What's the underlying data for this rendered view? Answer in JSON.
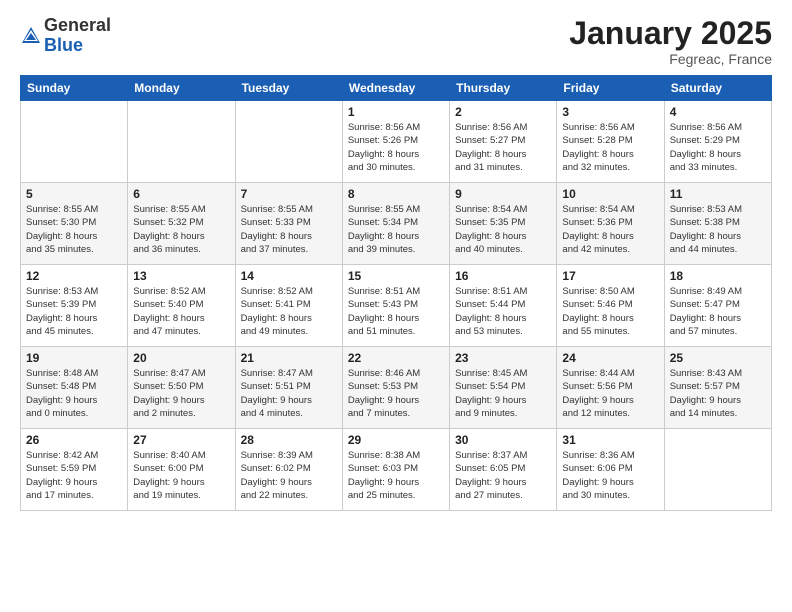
{
  "header": {
    "logo_line1": "General",
    "logo_line2": "Blue",
    "month": "January 2025",
    "location": "Fegreac, France"
  },
  "weekdays": [
    "Sunday",
    "Monday",
    "Tuesday",
    "Wednesday",
    "Thursday",
    "Friday",
    "Saturday"
  ],
  "weeks": [
    [
      {
        "day": "",
        "info": ""
      },
      {
        "day": "",
        "info": ""
      },
      {
        "day": "",
        "info": ""
      },
      {
        "day": "1",
        "info": "Sunrise: 8:56 AM\nSunset: 5:26 PM\nDaylight: 8 hours\nand 30 minutes."
      },
      {
        "day": "2",
        "info": "Sunrise: 8:56 AM\nSunset: 5:27 PM\nDaylight: 8 hours\nand 31 minutes."
      },
      {
        "day": "3",
        "info": "Sunrise: 8:56 AM\nSunset: 5:28 PM\nDaylight: 8 hours\nand 32 minutes."
      },
      {
        "day": "4",
        "info": "Sunrise: 8:56 AM\nSunset: 5:29 PM\nDaylight: 8 hours\nand 33 minutes."
      }
    ],
    [
      {
        "day": "5",
        "info": "Sunrise: 8:55 AM\nSunset: 5:30 PM\nDaylight: 8 hours\nand 35 minutes."
      },
      {
        "day": "6",
        "info": "Sunrise: 8:55 AM\nSunset: 5:32 PM\nDaylight: 8 hours\nand 36 minutes."
      },
      {
        "day": "7",
        "info": "Sunrise: 8:55 AM\nSunset: 5:33 PM\nDaylight: 8 hours\nand 37 minutes."
      },
      {
        "day": "8",
        "info": "Sunrise: 8:55 AM\nSunset: 5:34 PM\nDaylight: 8 hours\nand 39 minutes."
      },
      {
        "day": "9",
        "info": "Sunrise: 8:54 AM\nSunset: 5:35 PM\nDaylight: 8 hours\nand 40 minutes."
      },
      {
        "day": "10",
        "info": "Sunrise: 8:54 AM\nSunset: 5:36 PM\nDaylight: 8 hours\nand 42 minutes."
      },
      {
        "day": "11",
        "info": "Sunrise: 8:53 AM\nSunset: 5:38 PM\nDaylight: 8 hours\nand 44 minutes."
      }
    ],
    [
      {
        "day": "12",
        "info": "Sunrise: 8:53 AM\nSunset: 5:39 PM\nDaylight: 8 hours\nand 45 minutes."
      },
      {
        "day": "13",
        "info": "Sunrise: 8:52 AM\nSunset: 5:40 PM\nDaylight: 8 hours\nand 47 minutes."
      },
      {
        "day": "14",
        "info": "Sunrise: 8:52 AM\nSunset: 5:41 PM\nDaylight: 8 hours\nand 49 minutes."
      },
      {
        "day": "15",
        "info": "Sunrise: 8:51 AM\nSunset: 5:43 PM\nDaylight: 8 hours\nand 51 minutes."
      },
      {
        "day": "16",
        "info": "Sunrise: 8:51 AM\nSunset: 5:44 PM\nDaylight: 8 hours\nand 53 minutes."
      },
      {
        "day": "17",
        "info": "Sunrise: 8:50 AM\nSunset: 5:46 PM\nDaylight: 8 hours\nand 55 minutes."
      },
      {
        "day": "18",
        "info": "Sunrise: 8:49 AM\nSunset: 5:47 PM\nDaylight: 8 hours\nand 57 minutes."
      }
    ],
    [
      {
        "day": "19",
        "info": "Sunrise: 8:48 AM\nSunset: 5:48 PM\nDaylight: 9 hours\nand 0 minutes."
      },
      {
        "day": "20",
        "info": "Sunrise: 8:47 AM\nSunset: 5:50 PM\nDaylight: 9 hours\nand 2 minutes."
      },
      {
        "day": "21",
        "info": "Sunrise: 8:47 AM\nSunset: 5:51 PM\nDaylight: 9 hours\nand 4 minutes."
      },
      {
        "day": "22",
        "info": "Sunrise: 8:46 AM\nSunset: 5:53 PM\nDaylight: 9 hours\nand 7 minutes."
      },
      {
        "day": "23",
        "info": "Sunrise: 8:45 AM\nSunset: 5:54 PM\nDaylight: 9 hours\nand 9 minutes."
      },
      {
        "day": "24",
        "info": "Sunrise: 8:44 AM\nSunset: 5:56 PM\nDaylight: 9 hours\nand 12 minutes."
      },
      {
        "day": "25",
        "info": "Sunrise: 8:43 AM\nSunset: 5:57 PM\nDaylight: 9 hours\nand 14 minutes."
      }
    ],
    [
      {
        "day": "26",
        "info": "Sunrise: 8:42 AM\nSunset: 5:59 PM\nDaylight: 9 hours\nand 17 minutes."
      },
      {
        "day": "27",
        "info": "Sunrise: 8:40 AM\nSunset: 6:00 PM\nDaylight: 9 hours\nand 19 minutes."
      },
      {
        "day": "28",
        "info": "Sunrise: 8:39 AM\nSunset: 6:02 PM\nDaylight: 9 hours\nand 22 minutes."
      },
      {
        "day": "29",
        "info": "Sunrise: 8:38 AM\nSunset: 6:03 PM\nDaylight: 9 hours\nand 25 minutes."
      },
      {
        "day": "30",
        "info": "Sunrise: 8:37 AM\nSunset: 6:05 PM\nDaylight: 9 hours\nand 27 minutes."
      },
      {
        "day": "31",
        "info": "Sunrise: 8:36 AM\nSunset: 6:06 PM\nDaylight: 9 hours\nand 30 minutes."
      },
      {
        "day": "",
        "info": ""
      }
    ]
  ]
}
